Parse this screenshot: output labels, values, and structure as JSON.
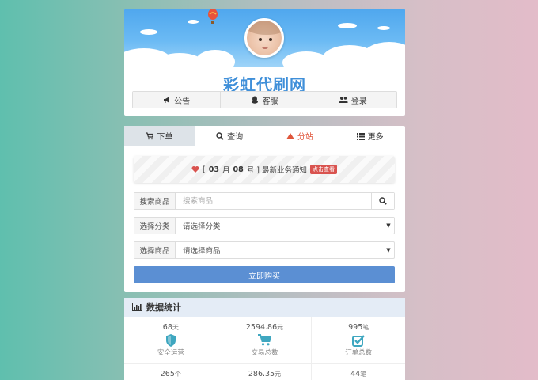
{
  "header": {
    "site_title": "彩虹代刷网",
    "nav": [
      {
        "label": "公告",
        "icon": "megaphone-icon"
      },
      {
        "label": "客服",
        "icon": "qq-penguin-icon"
      },
      {
        "label": "登录",
        "icon": "users-icon"
      }
    ]
  },
  "order": {
    "tabs": [
      {
        "label": "下单",
        "icon": "cart-icon",
        "active": true
      },
      {
        "label": "查询",
        "icon": "search-icon"
      },
      {
        "label": "分站",
        "icon": "sitemap-icon",
        "highlight": true
      },
      {
        "label": "更多",
        "icon": "list-icon"
      }
    ],
    "notice": {
      "prefix": "[",
      "month": "03",
      "mid": "月",
      "day": "08",
      "suffix": "号 ] 最新业务通知",
      "badge": "点击查看"
    },
    "search": {
      "label": "搜索商品",
      "placeholder": "搜索商品"
    },
    "category": {
      "label": "选择分类",
      "value": "请选择分类"
    },
    "product": {
      "label": "选择商品",
      "value": "请选择商品"
    },
    "buy_label": "立即购买"
  },
  "stats": {
    "title": "数据统计",
    "row1": [
      {
        "value": "68",
        "unit": "天",
        "label": "安全运营",
        "icon": "shield-icon"
      },
      {
        "value": "2594.86",
        "unit": "元",
        "label": "交易总数",
        "icon": "cart-icon"
      },
      {
        "value": "995",
        "unit": "笔",
        "label": "订单总数",
        "icon": "check-square-icon"
      }
    ],
    "row2": [
      {
        "value": "265",
        "unit": "个"
      },
      {
        "value": "286.35",
        "unit": "元"
      },
      {
        "value": "44",
        "unit": "笔"
      }
    ]
  },
  "colors": {
    "title_blue": "#3f8fd9",
    "buy_button": "#5b8fd3",
    "highlight_red": "#e0563b",
    "icon_teal": "#3fa7c0"
  }
}
